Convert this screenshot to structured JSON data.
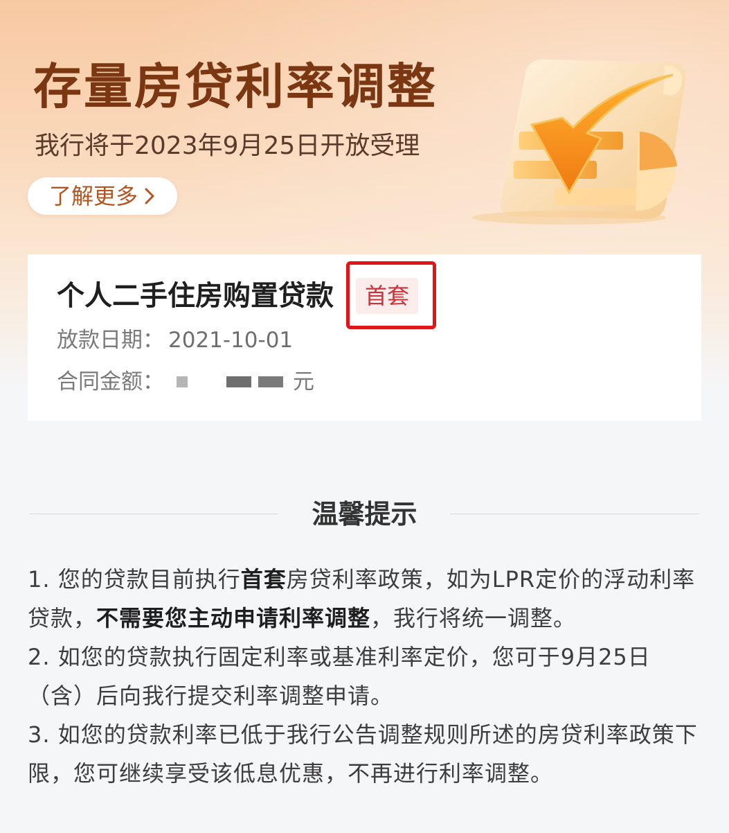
{
  "banner": {
    "title": "存量房贷利率调整",
    "subtitle": "我行将于2023年9月25日开放受理",
    "learn_more_label": "了解更多",
    "colors": {
      "title": "#7a3712",
      "accent": "#b5541f"
    },
    "illustration_icon": "document-down-arrow-icon"
  },
  "loan_card": {
    "title": "个人二手住房购置贷款",
    "tag": "首套",
    "date_label": "放款日期：",
    "date_value": "2021-10-01",
    "amount_label": "合同金额：",
    "amount_unit": "元",
    "colors": {
      "tag_text": "#c8333a",
      "tag_bg": "#fdecec",
      "highlight_border": "#e0151a"
    }
  },
  "tips": {
    "title": "温馨提示",
    "items": [
      {
        "p1": "1. 您的贷款目前执行",
        "b1": "首套",
        "p2": "房贷利率政策，如为LPR定价的浮动利率贷款，",
        "b2": "不需要您主动申请利率调整",
        "p3": "，我行将统一调整。"
      },
      {
        "text": "2. 如您的贷款执行固定利率或基准利率定价，您可于9月25日（含）后向我行提交利率调整申请。"
      },
      {
        "text": "3. 如您的贷款利率已低于我行公告调整规则所述的房贷利率政策下限，您可继续享受该低息优惠，不再进行利率调整。"
      }
    ]
  }
}
